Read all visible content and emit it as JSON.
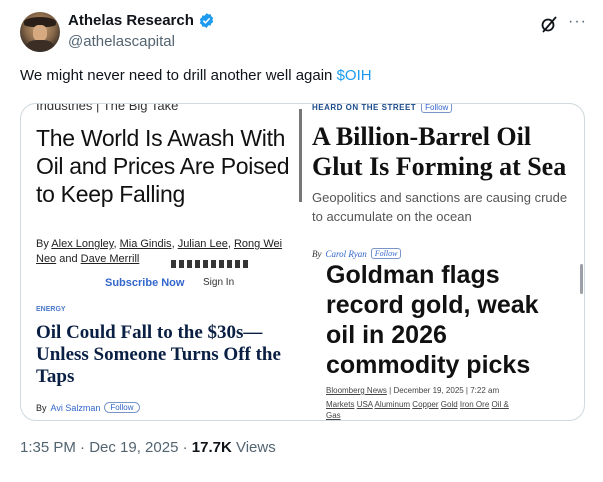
{
  "author": {
    "name": "Athelas Research",
    "handle": "@athelascapital"
  },
  "tweet": {
    "text": "We might never need to drill another well again ",
    "cashtag": "$OIH"
  },
  "card": {
    "article1": {
      "kicker": "Industries | The Big Take",
      "title": "The World Is Awash With Oil and Prices Are Poised to Keep Falling",
      "byline_prefix": "By ",
      "authors": [
        "Alex Longley",
        "Mia Gindis",
        "Julian Lee",
        "Rong Wei Neo",
        "Dave Merrill"
      ],
      "subscribe": "Subscribe Now",
      "signin": "Sign In"
    },
    "article2": {
      "kicker": "HEARD ON THE STREET",
      "follow": "Follow",
      "title": "A Billion-Barrel Oil Glut Is Forming at Sea",
      "dek": "Geopolitics and sanctions are causing crude to accumulate on the ocean",
      "byline_prefix": "By",
      "author": "Carol Ryan",
      "author_follow": "Follow"
    },
    "article3": {
      "kicker": "ENERGY",
      "title": "Oil Could Fall to the $30s—Unless Someone Turns Off the Taps",
      "byline_prefix": "By",
      "author": "Avi Salzman",
      "follow": "Follow"
    },
    "article4": {
      "title": "Goldman flags record gold, weak oil in 2026 commodity picks",
      "source": "Bloomberg News",
      "date": " | December 19, 2025 | 7:22 am",
      "tags": [
        "Markets",
        "USA",
        "Aluminum",
        "Copper",
        "Gold",
        "Iron Ore",
        "Oil &",
        "Gas"
      ]
    }
  },
  "footer": {
    "time": "1:35 PM · Dec 19, 2025 · ",
    "views_count": "17.7K",
    "views_label": " Views"
  },
  "icons": {
    "verified": "verified-badge-icon",
    "grok": "grok-icon",
    "more": "more-options-icon"
  },
  "colors": {
    "accent": "#1d9bf0",
    "text": "#0f1419",
    "muted": "#536471"
  }
}
